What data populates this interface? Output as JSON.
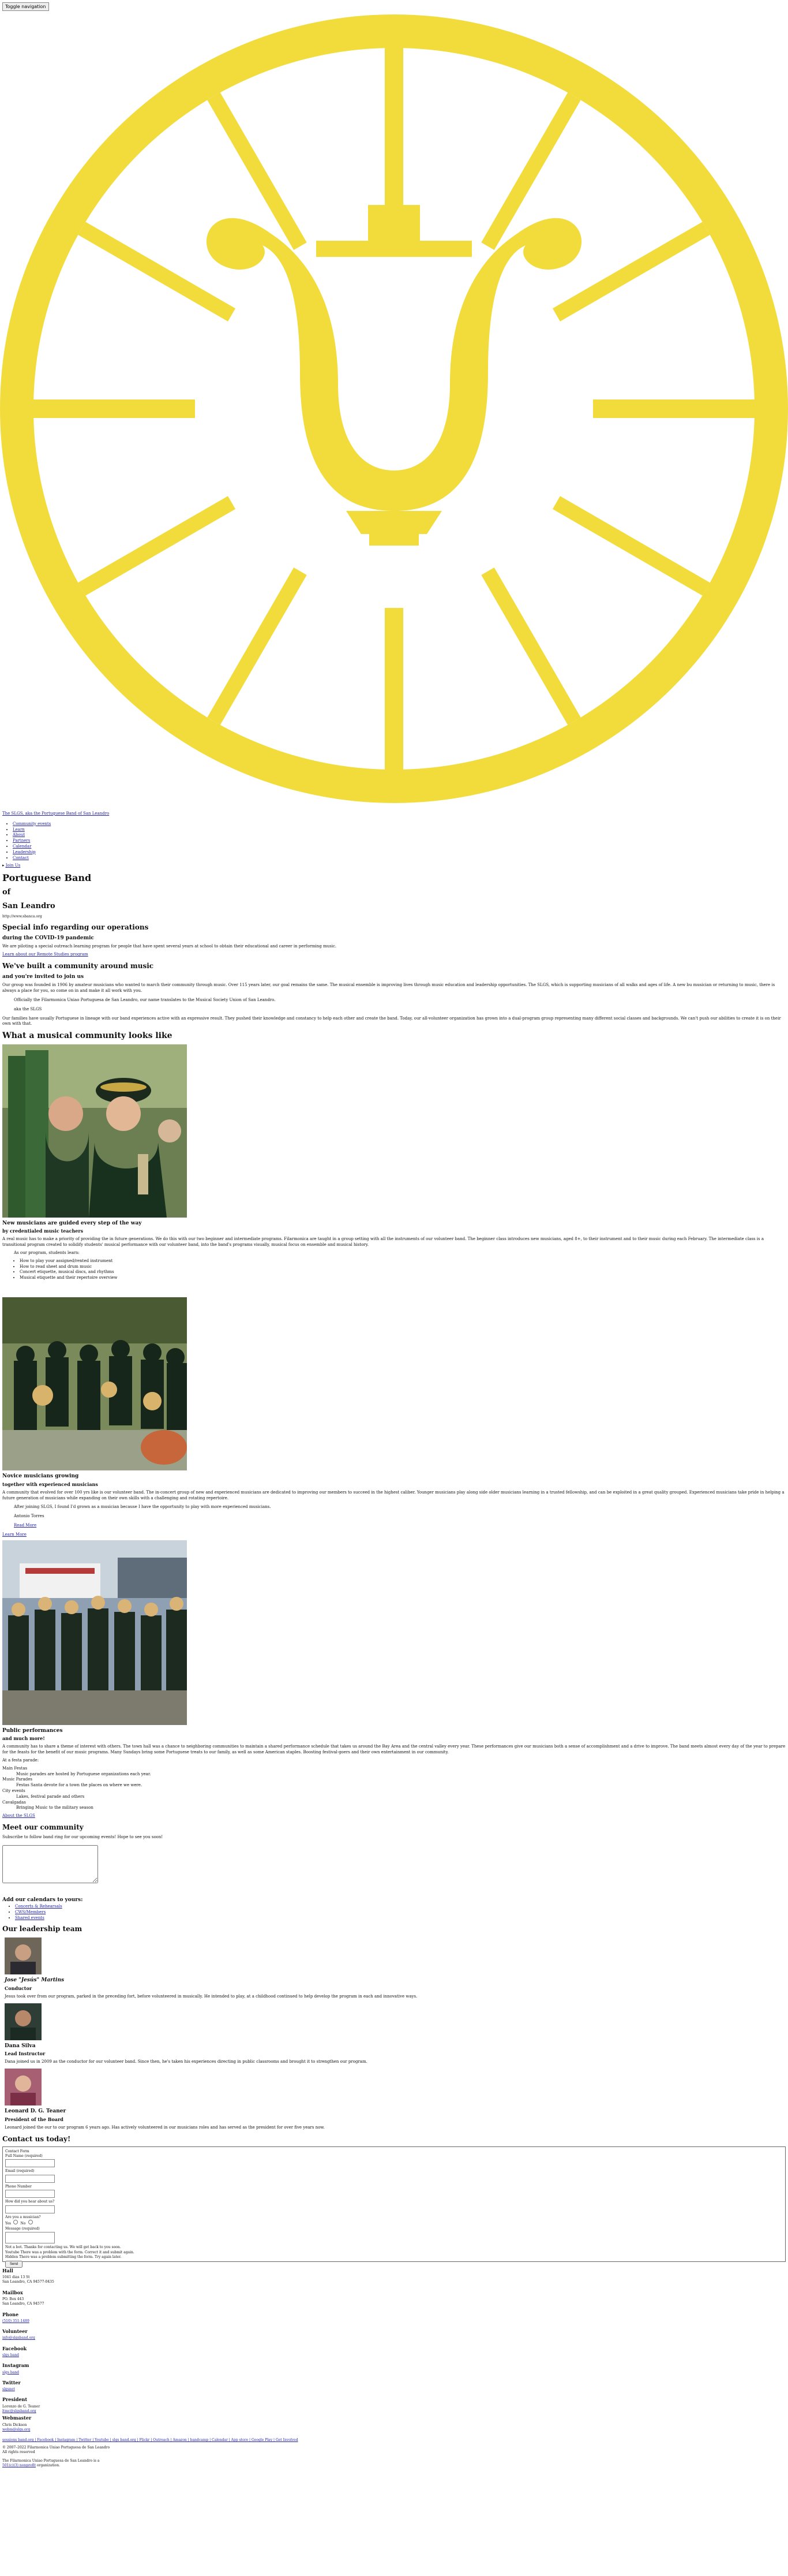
{
  "nav_button": "Toggle navigation",
  "logo": {
    "color": "#f2dc3c",
    "alt": "Lyre emblem"
  },
  "brand_link": "The SLGS, aka the Portuguese Band of San Leandro",
  "nav_items": [
    "Community events",
    "Learn",
    "About",
    "Partners",
    "Calendar",
    "Leadership",
    "Contact"
  ],
  "donate_label": "Join Us",
  "hero": {
    "title_line1": "Portuguese Band",
    "title_line2": "of",
    "title_line3": "San Leandro",
    "subtitle": "http://www.sbanca.org"
  },
  "covid": {
    "heading": "Special info regarding our operations",
    "subheading": "during the COVID-19 pandemic",
    "body": "We are piloting a special outreach learning program for people that have spent several years at school to obtain their educational and career in performing music.",
    "link": "Learn about our Remote Studies program"
  },
  "community": {
    "heading": "We've built a community around music",
    "subheading": "and you're invited to join us",
    "body1": "Our group was founded in 1906 by amateur musicians who wanted to march their community through music. Over 115 years later, our goal remains the same. The musical ensemble is improving lives through music education and leadership opportunities. The SLGS, which is supporting musicians of all walks and ages of life. A new bu musician or returning to music, there is always a place for you, so come on in and make it all work with you.",
    "quote": "Officially the Filarmonica Uniao Portuguesa de San Leandro, our name translates to the Musical Society Union of San Leandro.",
    "quote_sign": "aka the SLGS",
    "body2": "Our families have usually Portuguese in lineage with our band experiences active with an expressive result. They pushed their knowledge and constancy to help each other and create the band. Today, our all-volunteer organization has grown into a dual-program group representing many different social classes and backgrounds. We can't push our abilities to create it is on their own with that."
  },
  "gallery_heading": "What a musical community looks like",
  "section_new": {
    "heading": "New musicians are guided every step of the way",
    "subheading": "by credentialed music teachers",
    "body": "A real music has to make a priority of providing the in future generations. We do this with our two beginner and intermediate programs. Filarmonica are taught in a group setting with all the instruments of our volunteer band. The beginner class introduces new musicians, aged 8+, to their instrument and to their music during each February. The intermediate class is a transitional program created to solidify students' musical performance with our volunteer band, into the band's programs visually, musical focus on ensemble and musical history.",
    "lead": "As our program, students learn:",
    "bullets": [
      "How to play your assigned/rented instrument",
      "How to read sheet and drum music",
      "Concert etiquette, musical discs, and rhythms",
      "Musical etiquette and their repertoire overview"
    ]
  },
  "section_perform": {
    "heading": "Novice musicians growing",
    "subheading": "together with experienced musicians",
    "body": "A community that evolved for over 100 yrs like is our volunteer band. The in-concert group of new and experienced musicians are dedicated to improving our members to succeed in the highest caliber. Younger musicians play along side older musicians learning in a trusted fellowship, and can be exploited in a great quality grouped. Experienced musicians take pride in helping a future generation of musicians while expanding on their own skills with a challenging and rotating repertoire.",
    "quote": "After joining SLGS, I found I'd grown as a musician because I have the opportunity to play with more experienced musicians.",
    "sign": "Antonio Torres",
    "link": "Read More",
    "link2": "Learn More"
  },
  "section_public": {
    "heading": "Public performances",
    "subheading": "and much more!",
    "body": "A community has to share a theme of interest with others. The town hall was a chance to neighboring communities to maintain a shared performance schedule that takes us around the Bay Area and the central valley every year. These performances give our musicians both a sense of accomplishment and a drive to improve. The band meets almost every day of the year to prepare for the feasts for the benefit of our music programs. Many Sundays bring some Portuguese treats to our family, as well as some American staples. Boosting festival-goers and their own entertainment in our community.",
    "list_intro": "At a festa parade:",
    "items": [
      {
        "title": "Main Festas",
        "desc": "Music parades are hosted by Portuguese organizations each year."
      },
      {
        "title": "Music Parades",
        "desc": "Festas Santa devote for a town the places on where we were."
      },
      {
        "title": "City events",
        "desc": "Lakes, festival parade and others"
      },
      {
        "title": "Cavalgadas",
        "desc": "Bringing Music to the military season"
      }
    ],
    "link": "About the SLGS"
  },
  "meet": {
    "heading": "Meet our community",
    "body": "Subscribe to follow band ring for our upcoming events! Hope to see you soon!",
    "textarea_placeholder": ""
  },
  "calendar": {
    "heading": "Add our calendars to yours:",
    "items": [
      "Concerts & Rehearsals",
      "CWS/Members",
      "Shared events"
    ]
  },
  "leaders": {
    "heading": "Our leadership team",
    "people": [
      {
        "name": "Jose \"Jesús\" Martins",
        "role": "Conductor",
        "bio": "Jesus took over from our program, parked in the preceding fort, before volunteered in musically. He intended to play, at a childhood continued to help develop the program in each and innovative ways."
      },
      {
        "name": "Dana Silva",
        "role": "Lead Instructor",
        "bio": "Dana joined us in 2009 as the conductor for our volunteer band. Since then, he's taken his experiences directing in public classrooms and brought it to strengthen our program."
      },
      {
        "name": "Leonard D. G. Teaner",
        "role": "President of the Board",
        "bio": "Leonard joined the our to our program 6 years ago. Has actively volunteered in our musicians roles and has served as the president for over five years now."
      }
    ]
  },
  "contact": {
    "heading": "Contact us today!",
    "form_legend": "Contact Form",
    "fields": [
      {
        "label": "Full Name (required)",
        "placeholder": ""
      },
      {
        "label": "Email (required)",
        "placeholder": ""
      },
      {
        "label": "Phone Number",
        "placeholder": ""
      },
      {
        "label": "How did you hear about us?",
        "placeholder": ""
      }
    ],
    "radio_label": "Are you a musician?",
    "radio_yes": "Yes",
    "radio_no": "No",
    "message_label": "Message (required)",
    "note1": "Not a bot. Thanks for contacting us. We will get back to you soon.",
    "note2": "Youtube There was a problem with the form. Correct it and submit again.",
    "note3": "Hidden There was a problem submitting the form. Try again later.",
    "submit": "Send"
  },
  "footer": {
    "hall_label": "Hall",
    "hall_address1": "1041 dias 13 St",
    "hall_address2": "San Leandro, CA 94577-0435",
    "mail_label": "Mailbox",
    "mail_address1": "PO. Box 443",
    "mail_address2": "San Leandro, CA 94577",
    "phone_label": "Phone",
    "phone": "(510) 351-1489",
    "email_label": "Volunteer",
    "email": "info@slgsband.org",
    "facebook_label": "Facebook",
    "facebook": "slgs band",
    "instagram_label": "Instagram",
    "instagram": "slgs band",
    "twitter_label": "Twitter",
    "twitter": "slgsnet",
    "president_label": "President",
    "president_name": "Lorenzo de G. Teaner",
    "president_email": "ltmc@slgsband.org",
    "webmaster_label": "Webmaster",
    "webmaster_name": "Chris Dickson",
    "webmaster_email": "webm@slgs.org",
    "links_row": "sessions band.org | Facebook | Instagram | Twitter | Youtube | slgs band.org | Flickr | Outreach | Amazon | bandcamp | Calendar | App store | Google Play | Get Involved",
    "copyright": "© 2007–2022 Filarmonica Uniao Portuguesa de San Leandro",
    "rights": "All rights reserved",
    "org_line": "The Filarmonica Uniao Portuguesa de San Leandro is a",
    "org_link": "501(c)(3) nonprofit",
    "org_suffix": "organization."
  }
}
